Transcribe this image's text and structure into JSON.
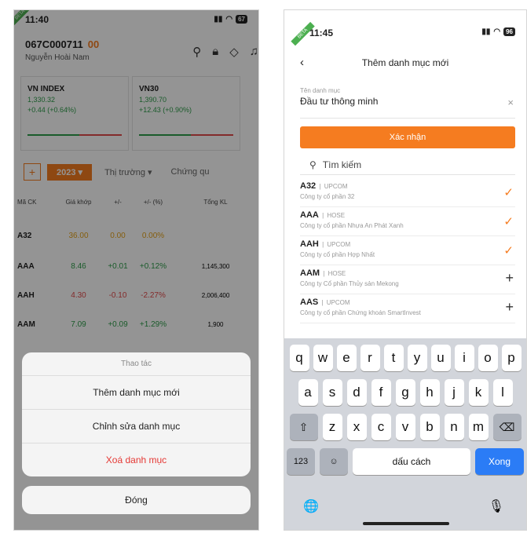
{
  "left": {
    "status": {
      "time": "11:40",
      "battery": "67",
      "tag": "BETA"
    },
    "account": {
      "number": "067C000711",
      "suffix": "00",
      "name": "Nguyễn Hoài Nam"
    },
    "indices": [
      {
        "name": "VN INDEX",
        "value": "1,330.32",
        "change": "+0.44 (+0.64%)"
      },
      {
        "name": "VN30",
        "value": "1,390.70",
        "change": "+12.43 (+0.90%)"
      }
    ],
    "tabs": {
      "add": "+",
      "year": "2023",
      "market": "Thị trường",
      "stock": "Chứng qu"
    },
    "table": {
      "headers": [
        "Mã CK",
        "Giá khớp",
        "+/-",
        "+/- (%)",
        "Tổng KL"
      ],
      "rows": [
        {
          "sym": "A32",
          "price": "36.00",
          "chg": "0.00",
          "pct": "0.00%",
          "vol": ""
        },
        {
          "sym": "AAA",
          "price": "8.46",
          "chg": "+0.01",
          "pct": "+0.12%",
          "vol": "1,145,300"
        },
        {
          "sym": "AAH",
          "price": "4.30",
          "chg": "-0.10",
          "pct": "-2.27%",
          "vol": "2,006,400"
        },
        {
          "sym": "AAM",
          "price": "7.09",
          "chg": "+0.09",
          "pct": "+1.29%",
          "vol": "1,900"
        }
      ]
    },
    "sheet": {
      "title": "Thao tác",
      "options": [
        "Thêm danh mục mới",
        "Chỉnh sửa danh mục",
        "Xoá danh mục"
      ],
      "close": "Đóng"
    }
  },
  "right": {
    "status": {
      "time": "11:45",
      "battery": "96",
      "tag": "BETA"
    },
    "nav": {
      "back": "‹",
      "title": "Thêm danh mục mới"
    },
    "field": {
      "label": "Tên danh mục",
      "value": "Đầu tư thông minh",
      "clear": "×"
    },
    "confirm": "Xác nhận",
    "search": {
      "placeholder": "Tìm kiếm"
    },
    "items": [
      {
        "sym": "A32",
        "ex": "UPCOM",
        "company": "Công ty cổ phần 32",
        "state": "✓"
      },
      {
        "sym": "AAA",
        "ex": "HOSE",
        "company": "Công ty cổ phần Nhựa An Phát Xanh",
        "state": "✓"
      },
      {
        "sym": "AAH",
        "ex": "UPCOM",
        "company": "Công ty cổ phần Hợp Nhất",
        "state": "✓"
      },
      {
        "sym": "AAM",
        "ex": "HOSE",
        "company": "Công ty Cổ phần Thủy sản Mekong",
        "state": "+"
      },
      {
        "sym": "AAS",
        "ex": "UPCOM",
        "company": "Công ty cổ phần Chứng khoán SmartInvest",
        "state": "+"
      }
    ],
    "keyboard": {
      "row1": [
        "q",
        "w",
        "e",
        "r",
        "t",
        "y",
        "u",
        "i",
        "o",
        "p"
      ],
      "row2": [
        "a",
        "s",
        "d",
        "f",
        "g",
        "h",
        "j",
        "k",
        "l"
      ],
      "row3": [
        "z",
        "x",
        "c",
        "v",
        "b",
        "n",
        "m"
      ],
      "shift": "⇧",
      "backspace": "⌫",
      "num": "123",
      "emoji": "☺",
      "space": "dấu cách",
      "done": "Xong",
      "globe": "🌐",
      "mic": "🎙"
    }
  }
}
